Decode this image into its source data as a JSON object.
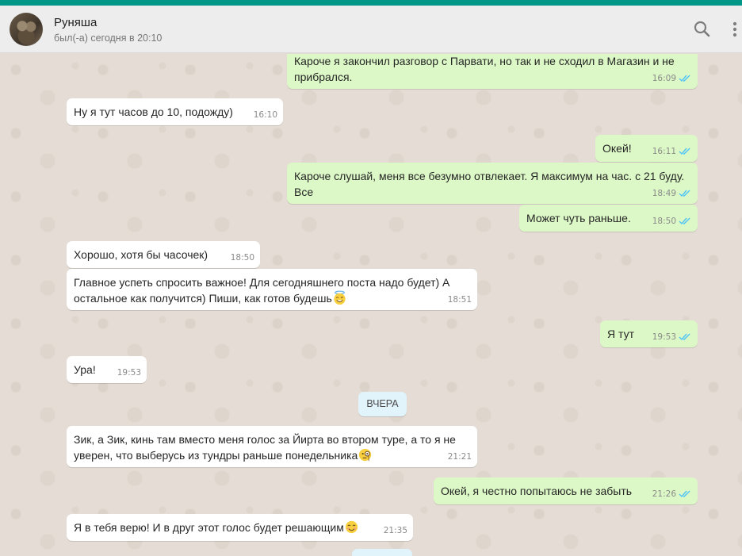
{
  "header": {
    "contact_name": "Руняша",
    "status": "был(-а) сегодня в 20:10",
    "search_icon": "search-icon",
    "menu_icon": "kebab-menu-icon"
  },
  "colors": {
    "accent": "#009688",
    "incoming_bubble": "#ffffff",
    "outgoing_bubble": "#dcf8c6",
    "read_check": "#4fc3f7",
    "date_pill": "#e1f3fb"
  },
  "date_separator": "ВЧЕРА",
  "messages": [
    {
      "dir": "out",
      "text": "Кароче я закончил разговор с Парвати, но так и не сходил в Магазин и не прибрался.",
      "time": "16:09",
      "status": "read"
    },
    {
      "dir": "in",
      "text": "Ну я тут часов до 10, подожду)",
      "time": "16:10"
    },
    {
      "dir": "out",
      "text": "Окей!",
      "time": "16:11",
      "status": "read"
    },
    {
      "dir": "out",
      "text": "Кароче слушай, меня все безумно отвлекает. Я максимум на час.  с 21 буду. Все",
      "time": "18:49",
      "status": "read"
    },
    {
      "dir": "out",
      "text": "Может чуть раньше.",
      "time": "18:50",
      "status": "read"
    },
    {
      "dir": "in",
      "text": "Хорошо, хотя бы часочек)",
      "time": "18:50"
    },
    {
      "dir": "in",
      "text": "Главное успеть спросить важное! Для сегодняшнего поста надо будет) А остальное как получится) Пиши, как готов будешь",
      "emoji": "smiling-face-with-halo",
      "time": "18:51"
    },
    {
      "dir": "out",
      "text": "Я тут",
      "time": "19:53",
      "status": "read"
    },
    {
      "dir": "in",
      "text": "Ура!",
      "time": "19:53"
    },
    {
      "dir": "in",
      "text": "Зик, а Зик, кинь там вместо меня голос за Йирта во втором туре, а то я не уверен, что выберусь из тундры раньше понедельника",
      "emoji": "face-with-monocle",
      "time": "21:21"
    },
    {
      "dir": "out",
      "text": "Окей, я честно попытаюсь не забыть",
      "time": "21:26",
      "status": "read"
    },
    {
      "dir": "in",
      "text": "Я в тебя верю! И в друг этот голос будет решающим",
      "emoji": "smiling-face-with-smiling-eyes",
      "time": "21:35"
    }
  ]
}
